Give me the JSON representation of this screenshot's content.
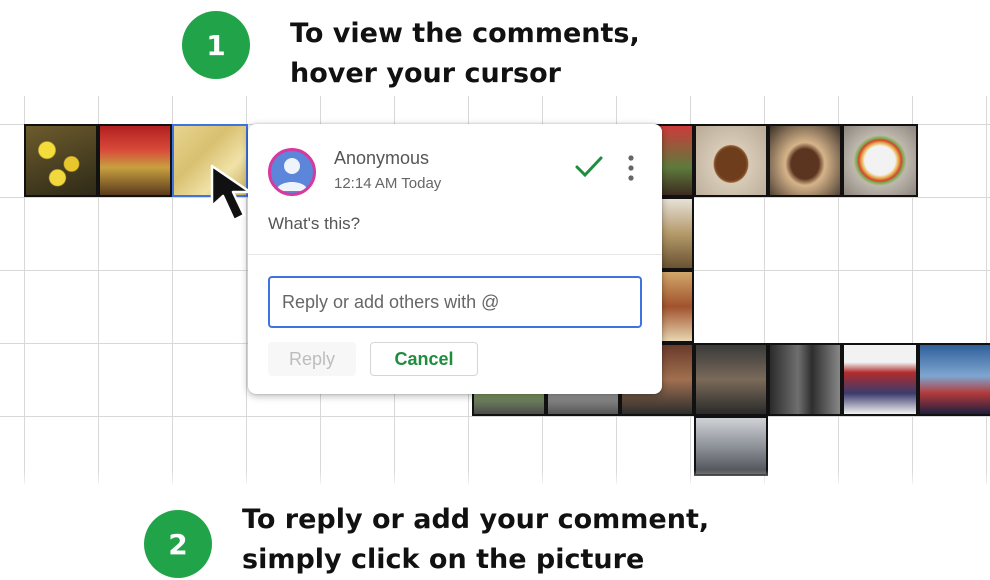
{
  "steps": [
    {
      "number": "1",
      "line1": "To view the comments,",
      "line2": "hover your cursor"
    },
    {
      "number": "2",
      "line1": "To reply or add your comment,",
      "line2": "simply click on the picture"
    }
  ],
  "comment": {
    "author": "Anonymous",
    "timestamp": "12:14 AM Today",
    "text": "What's this?",
    "reply_placeholder": "Reply or add others with @",
    "reply_label": "Reply",
    "cancel_label": "Cancel"
  },
  "icons": {
    "resolve": "check-icon",
    "more": "more-vert-icon",
    "avatar": "person-icon",
    "pointer": "cursor-arrow-icon"
  },
  "colors": {
    "step_badge": "#21a449",
    "check": "#1e8e3e",
    "input_focus": "#3f74e0",
    "avatar_ring": "#d6399f",
    "avatar_fill": "#5b86d9"
  }
}
